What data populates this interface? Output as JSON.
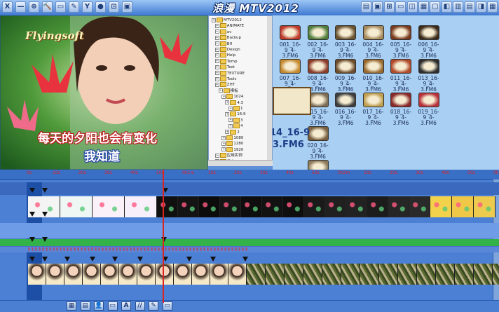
{
  "app_title": "浪漫 MTV2012",
  "toolbar_left": [
    "X",
    "—",
    "⊕",
    "🔨",
    "▭",
    "✎",
    "Y",
    "●",
    "⊡",
    "▣"
  ],
  "toolbar_right": [
    "▤",
    "▣",
    "⊞",
    "▭",
    "◫",
    "▦",
    "▢",
    "◧",
    "▥",
    "▤",
    "◨",
    "▦"
  ],
  "preview": {
    "brand": "Flyingsoft",
    "lyric_line1": "每天的夕阳也会有变化",
    "lyric_line2": "我知道"
  },
  "tree": {
    "rows": [
      "MTV2012",
      "ANIMATE",
      "av",
      "Backup",
      "Bfl",
      "Design",
      "Help",
      "Temp",
      "Text",
      "TEXTURE",
      "Tools",
      "ZHT",
      "模板",
      "1024",
      "4:3",
      "1",
      "16:9",
      "3",
      "4",
      "2",
      "1080",
      "1280",
      "1920",
      "应用实例",
      "日志"
    ]
  },
  "gallery": {
    "thumbs": [
      {
        "label": "001_16-9_4-3.FM6",
        "color": "#c0392b"
      },
      {
        "label": "002_16-9_4-3.FM6",
        "color": "#4f7d3b"
      },
      {
        "label": "003_16-9_4-3.FM6",
        "color": "#6b5330"
      },
      {
        "label": "004_16-9_4-3.FM6",
        "color": "#a88b5d"
      },
      {
        "label": "005_16-9_4-3.FM6",
        "color": "#7a3a1e"
      },
      {
        "label": "006_16-9_4-3.FM6",
        "color": "#3a2a1a"
      },
      {
        "label": "007_16-9_4-3.FM6",
        "color": "#c58a2d"
      },
      {
        "label": "008_16-9_4-3.FM6",
        "color": "#8c3c2a"
      },
      {
        "label": "009_16-9_4-3.FM6",
        "color": "#6d4d2c"
      },
      {
        "label": "010_16-9_4-3.FM6",
        "color": "#9a6a30"
      },
      {
        "label": "011_16-9_4-3.FM6",
        "color": "#b04a2a"
      },
      {
        "label": "013_16-9_4-3.FM6",
        "color": "#2d2d2d"
      },
      {
        "label": "015_16-9_4-3.FM6",
        "color": "#7d6d54"
      },
      {
        "label": "016_16-9_4-3.FM6",
        "color": "#3e3e3e"
      },
      {
        "label": "017_16-9_4-3.FM6",
        "color": "#c0a050"
      },
      {
        "label": "018_16-9_4-3.FM6",
        "color": "#8a2a2a"
      },
      {
        "label": "019_16-9_4-3.FM6",
        "color": "#b8323a"
      },
      {
        "label": "020_16-9_4-3.FM6",
        "color": "#7a6040"
      },
      {
        "label": "021_16-9_4-3.FM6",
        "color": "#8d7a5a"
      }
    ],
    "drag_label_line1": "14_16-9",
    "drag_label_line2": "3.FM6"
  },
  "timeline": {
    "ruler_labels": [
      "0s",
      "10s",
      "20s",
      "30s",
      "40s",
      "50s",
      "0h1m",
      "10s",
      "20s",
      "30s",
      "40s",
      "50s",
      "0h2m",
      "10s",
      "20s",
      "30s",
      "40s",
      "50s",
      "0h3m"
    ],
    "lyric_marks": "§§§§§§§§§§§§§§§§§§§§§§§§§§§§§§§§§§§§§§§§§§§§§§§§§§§§§§§§§§§§§§§"
  },
  "bottom_bar": [
    "▦",
    "▤",
    "👤",
    "▭",
    "A",
    "//",
    "✎",
    "▭"
  ]
}
